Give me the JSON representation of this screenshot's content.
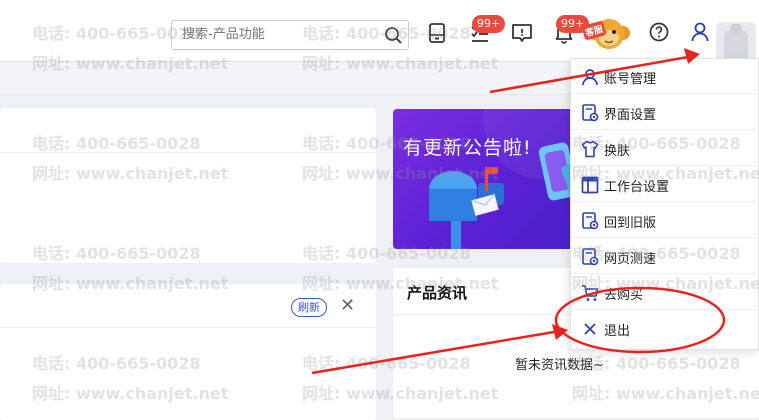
{
  "search": {
    "placeholder": "搜索-产品功能"
  },
  "header": {
    "badges": {
      "todo_count": "99+",
      "notice_count": "99+"
    },
    "kefu_label": "客服"
  },
  "user_menu": {
    "items": [
      {
        "label": "账号管理",
        "icon": "user-icon"
      },
      {
        "label": "界面设置",
        "icon": "settings-doc-icon"
      },
      {
        "label": "换肤",
        "icon": "shirt-icon"
      },
      {
        "label": "工作台设置",
        "icon": "layout-icon"
      },
      {
        "label": "回到旧版",
        "icon": "settings-doc-icon"
      },
      {
        "label": "网页测速",
        "icon": "settings-doc-icon"
      },
      {
        "label": "去购买",
        "icon": "cart-icon"
      },
      {
        "label": "退出",
        "icon": "close-icon"
      }
    ]
  },
  "card_b": {
    "refresh_label": "刷新"
  },
  "banner": {
    "text": "有更新公告啦!"
  },
  "news": {
    "title": "产品资讯",
    "empty_text": "暂未资讯数据~"
  },
  "watermark": {
    "phone": "电话: 400-665-0028",
    "site": "网址: www.chanjet.net"
  },
  "colors": {
    "accent": "#3c56c8",
    "badge": "#e94a3d",
    "annotation": "#e8231b",
    "banner": "#6a28dc"
  }
}
